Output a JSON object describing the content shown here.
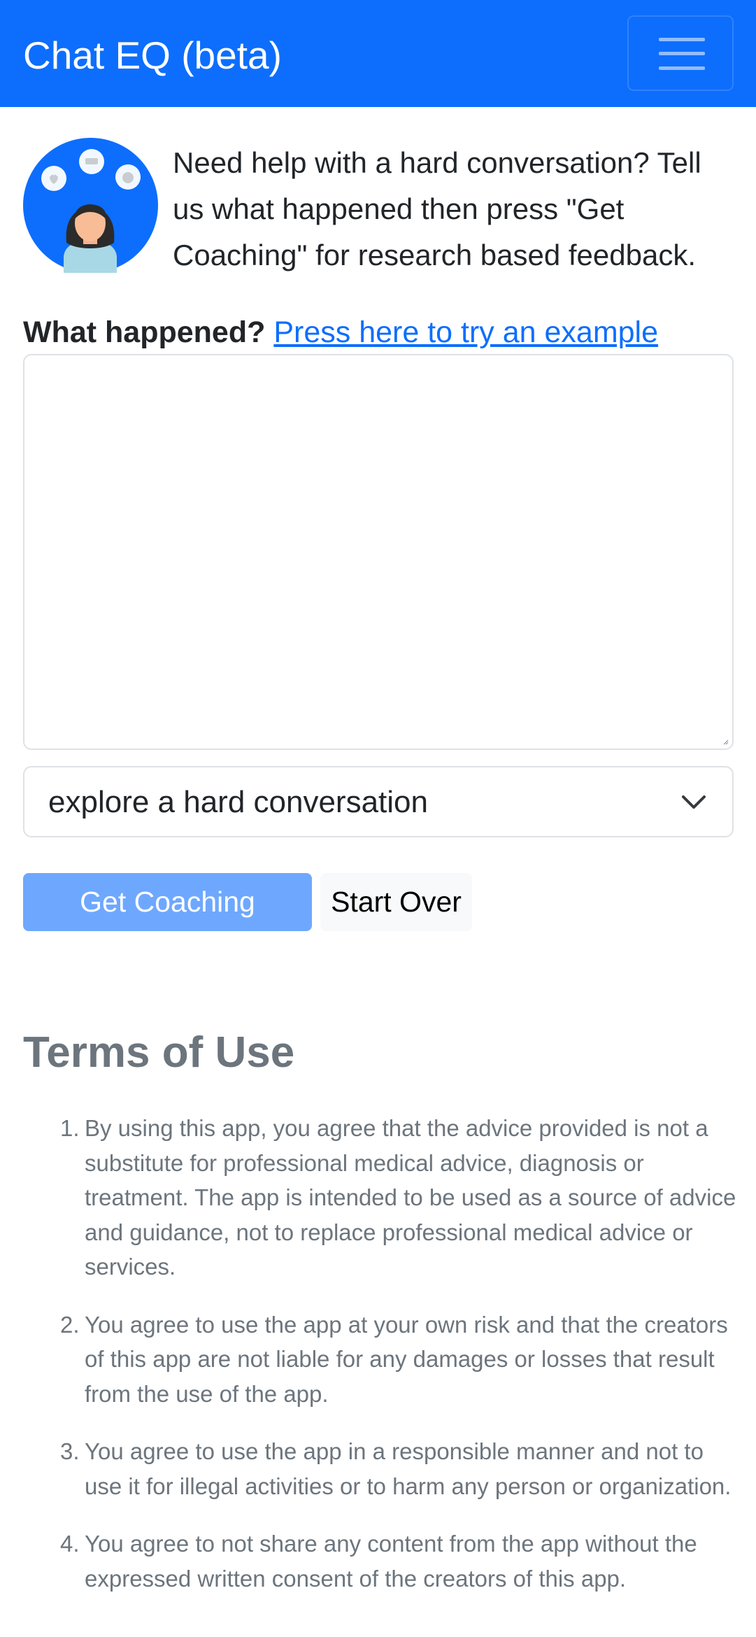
{
  "header": {
    "brand": "Chat EQ (beta)"
  },
  "intro": {
    "text": "Need help with a hard conversation? Tell us what happened then press \"Get Coaching\" for research based feedback."
  },
  "form": {
    "label": "What happened?",
    "example_link": "Press here to try an example",
    "textarea_value": "",
    "select_value": "explore a hard conversation"
  },
  "buttons": {
    "get_coaching": "Get Coaching",
    "start_over": "Start Over"
  },
  "terms": {
    "title": "Terms of Use",
    "items": [
      {
        "num": "1.",
        "text": "By using this app, you agree that the advice provided is not a substitute for professional medical advice, diagnosis or treatment. The app is intended to be used as a source of advice and guidance, not to replace professional medical advice or services."
      },
      {
        "num": "2.",
        "text": "You agree to use the app at your own risk and that the creators of this app are not liable for any damages or losses that result from the use of the app."
      },
      {
        "num": "3.",
        "text": "You agree to use the app in a responsible manner and not to use it for illegal activities or to harm any person or organization."
      },
      {
        "num": "4.",
        "text": "You agree to not share any content from the app without the expressed written consent of the creators of this app."
      }
    ]
  },
  "colors": {
    "primary": "#0d6efd",
    "primary_disabled": "#6ea8fe",
    "muted_text": "#6c757d",
    "border": "#dee2e6"
  },
  "icons": {
    "menu": "hamburger-menu-icon",
    "avatar": "coach-avatar-icon",
    "select_arrow": "chevron-down-icon"
  }
}
